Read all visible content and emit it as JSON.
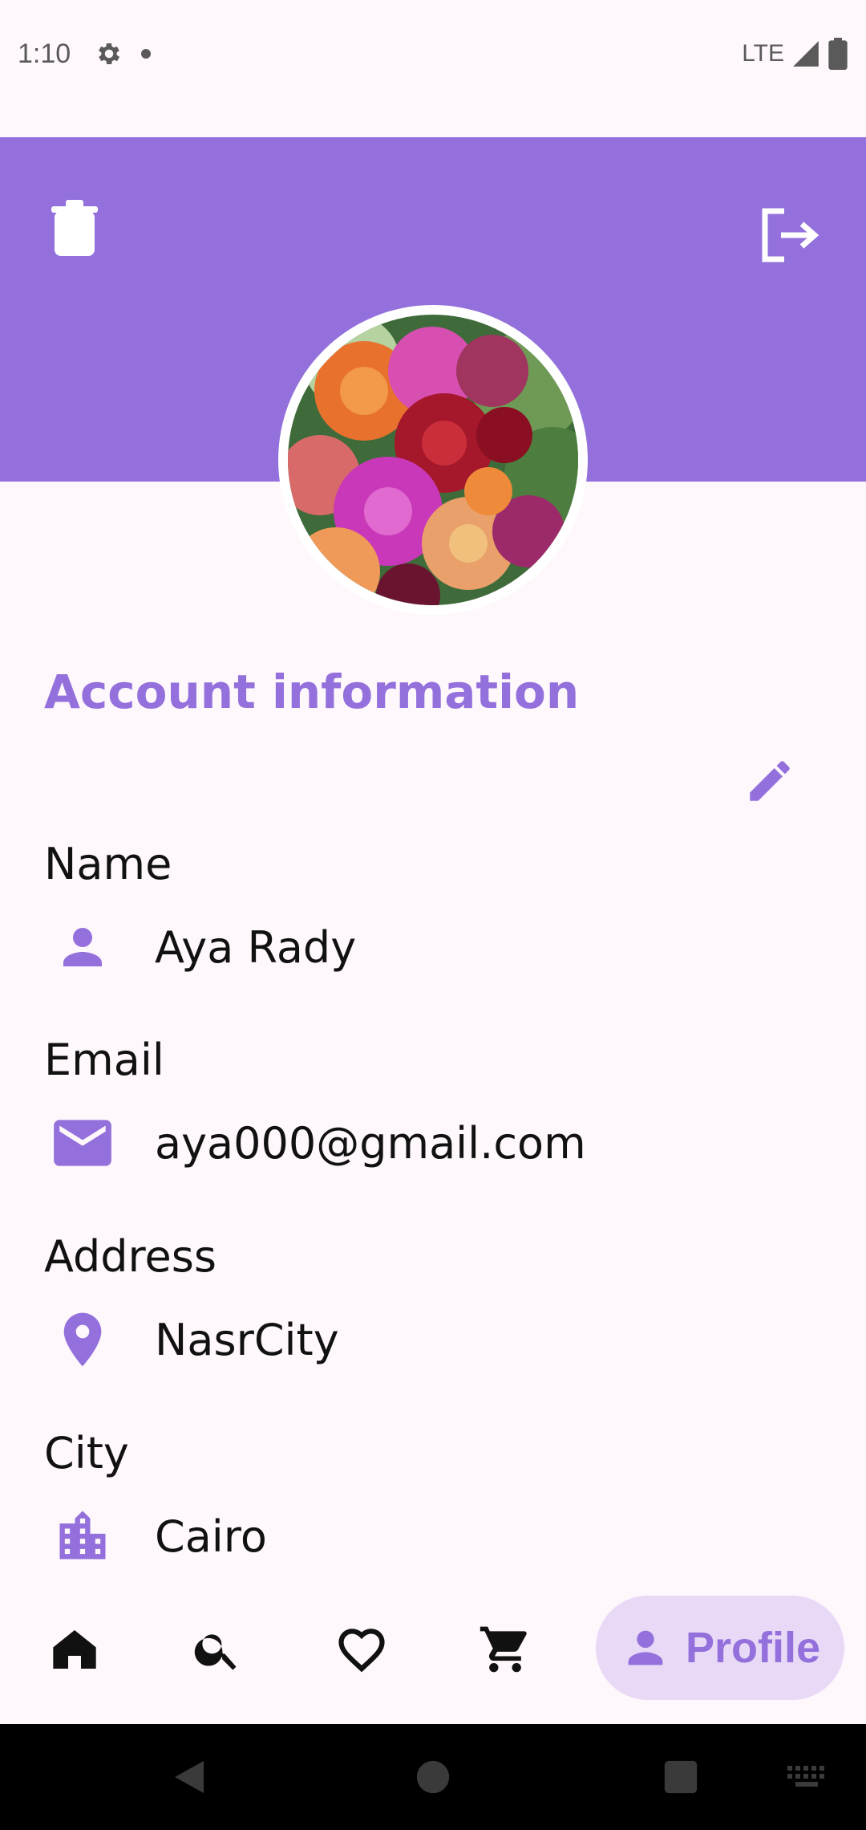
{
  "status_bar": {
    "time": "1:10",
    "network": "LTE"
  },
  "header": {
    "delete_icon": "delete-icon",
    "logout_icon": "logout-icon",
    "band_color": "#9370db"
  },
  "profile": {
    "avatar": "dahlia-flowers-photo"
  },
  "account": {
    "title": "Account information",
    "edit_icon": "pencil-icon",
    "fields": [
      {
        "label": "Name",
        "value": "Aya Rady",
        "icon": "person-icon"
      },
      {
        "label": "Email",
        "value": "aya000@gmail.com",
        "icon": "mail-icon"
      },
      {
        "label": "Address",
        "value": "NasrCity",
        "icon": "location-pin-icon"
      },
      {
        "label": "City",
        "value": "Cairo",
        "icon": "city-icon"
      }
    ]
  },
  "bottom_nav": {
    "items": [
      {
        "name": "home",
        "icon": "home-icon"
      },
      {
        "name": "search",
        "icon": "search-icon"
      },
      {
        "name": "favorites",
        "icon": "heart-icon"
      },
      {
        "name": "cart",
        "icon": "cart-icon"
      }
    ],
    "active": {
      "label": "Profile",
      "icon": "person-icon"
    }
  },
  "colors": {
    "accent": "#9370db",
    "background": "#fef7fc",
    "active_pill": "#e8d9f6"
  }
}
